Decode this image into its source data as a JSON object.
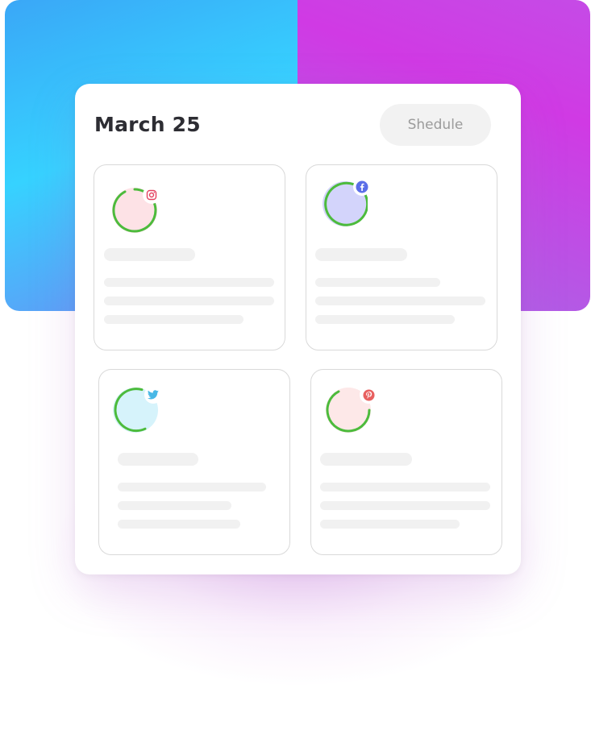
{
  "header": {
    "date": "March 25",
    "schedule_label": "Shedule"
  },
  "posts": [
    {
      "network_icon": "instagram-icon",
      "avatar_color": "#fde2e6",
      "badge_color": "#e4405f"
    },
    {
      "network_icon": "facebook-icon",
      "avatar_color": "#d3d4fb",
      "badge_color": "#5b6ee8"
    },
    {
      "network_icon": "twitter-icon",
      "avatar_color": "#d6f3fb",
      "badge_color": "#49b8e6"
    },
    {
      "network_icon": "pinterest-icon",
      "avatar_color": "#fde8e8",
      "badge_color": "#e8605f"
    }
  ],
  "colors": {
    "ring": "#4cbb3c",
    "gradient_left": "#36d2ff",
    "gradient_right": "#d03ae4"
  }
}
